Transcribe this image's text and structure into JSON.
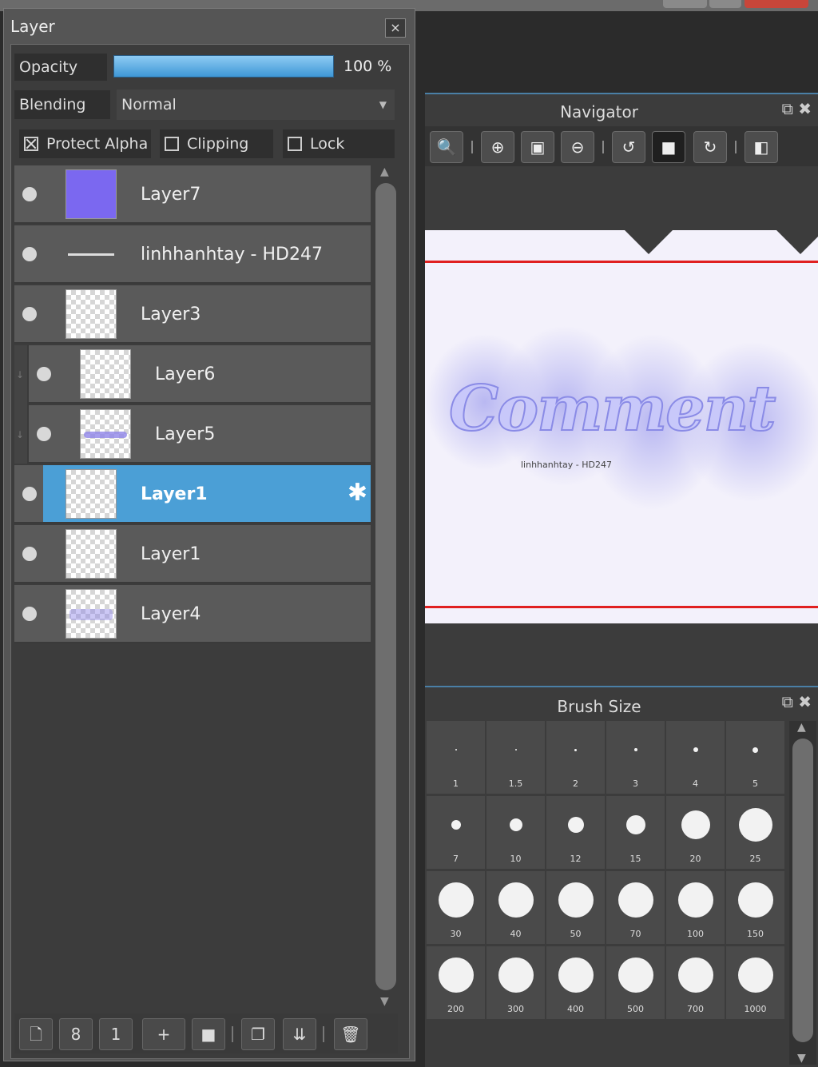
{
  "layer_panel": {
    "title": "Layer",
    "close_icon": "×",
    "opacity_label": "Opacity",
    "opacity_value": "100 %",
    "opacity_fraction": 1.0,
    "blending_label": "Blending",
    "blending_value": "Normal",
    "protect_alpha": {
      "label": "Protect Alpha",
      "checked": true
    },
    "clipping": {
      "label": "Clipping",
      "checked": false
    },
    "lock": {
      "label": "Lock",
      "checked": false
    },
    "layers": [
      {
        "name": "Layer7"
      },
      {
        "name": "linhhanhtay - HD247"
      },
      {
        "name": "Layer3"
      },
      {
        "name": "Layer6"
      },
      {
        "name": "Layer5"
      },
      {
        "name": "Layer1"
      },
      {
        "name": "Layer1"
      },
      {
        "name": "Layer4"
      }
    ],
    "toolbar_icons": {
      "new_layer": "🗋",
      "new_8bit_layer": "8",
      "new_1bit_layer": "1",
      "add_menu": "+",
      "new_folder": "■",
      "duplicate": "❐",
      "merge_down": "⇊",
      "delete": "🗑"
    }
  },
  "navigator": {
    "title": "Navigator",
    "artwork_text": "Comment",
    "artwork_subtext": "linhhanhtay - HD247",
    "tool_icons": {
      "zoom_reset": "🔍",
      "zoom_in": "⊕",
      "fit": "▣",
      "zoom_out": "⊖",
      "rotate_left": "↺",
      "fullscreen": "■",
      "rotate_right": "↻",
      "flip": "◧"
    }
  },
  "brush_size": {
    "title": "Brush Size",
    "sizes": [
      "1",
      "1.5",
      "2",
      "3",
      "4",
      "5",
      "7",
      "10",
      "12",
      "15",
      "20",
      "25",
      "30",
      "40",
      "50",
      "70",
      "100",
      "150",
      "200",
      "300",
      "400",
      "500",
      "700",
      "1000"
    ]
  },
  "colors": {
    "accent_blue": "#4b9fd6",
    "selection_border": "#e02020",
    "layer7_thumb": "#7b68f0"
  }
}
